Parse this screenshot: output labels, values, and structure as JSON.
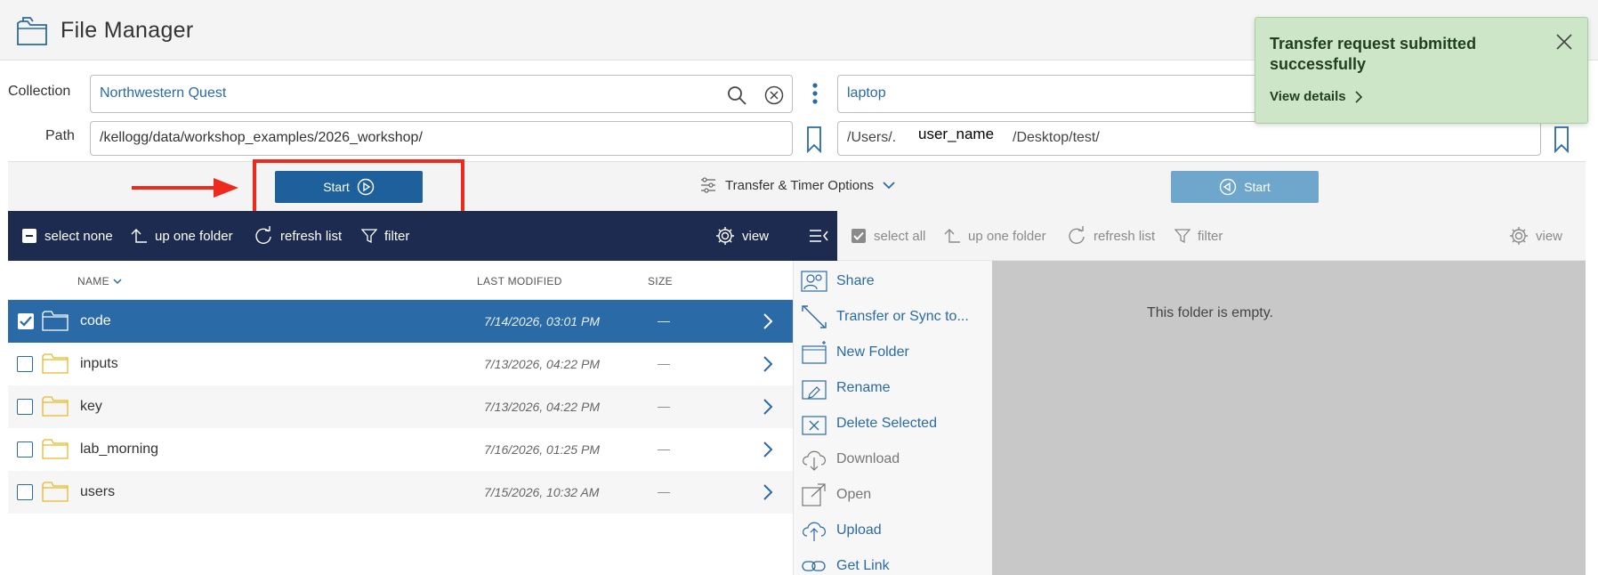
{
  "header": {
    "title": "File Manager",
    "icon": "folder-outline-icon"
  },
  "left": {
    "collection_label": "Collection",
    "collection_value": "Northwestern Quest",
    "path_label": "Path",
    "path_value": "/kellogg/data/workshop_examples/2026_workshop/"
  },
  "right": {
    "collection_value": "laptop",
    "path_prefix": "/Users/.",
    "path_user": "user_name",
    "path_suffix": "/Desktop/test/"
  },
  "transfer": {
    "start_label": "Start",
    "options_label": "Transfer & Timer Options",
    "start_right_label": "Start"
  },
  "left_toolbar": {
    "select": "select none",
    "up": "up one folder",
    "refresh": "refresh list",
    "filter": "filter",
    "view": "view"
  },
  "right_toolbar": {
    "select": "select all",
    "up": "up one folder",
    "refresh": "refresh list",
    "filter": "filter",
    "view": "view"
  },
  "file_list": {
    "col_name": "NAME",
    "col_modified": "LAST MODIFIED",
    "col_size": "SIZE",
    "rows": [
      {
        "name": "code",
        "modified": "7/14/2026, 03:01 PM",
        "size": "—",
        "selected": true
      },
      {
        "name": "inputs",
        "modified": "7/13/2026, 04:22 PM",
        "size": "—",
        "selected": false
      },
      {
        "name": "key",
        "modified": "7/13/2026, 04:22 PM",
        "size": "—",
        "selected": false
      },
      {
        "name": "lab_morning",
        "modified": "7/16/2026, 01:25 PM",
        "size": "—",
        "selected": false
      },
      {
        "name": "users",
        "modified": "7/15/2026, 10:32 AM",
        "size": "—",
        "selected": false
      }
    ]
  },
  "menu": {
    "items": [
      {
        "label": "Share",
        "enabled": true
      },
      {
        "label": "Transfer or Sync to...",
        "enabled": true
      },
      {
        "label": "New Folder",
        "enabled": true
      },
      {
        "label": "Rename",
        "enabled": true
      },
      {
        "label": "Delete Selected",
        "enabled": true
      },
      {
        "label": "Download",
        "enabled": false
      },
      {
        "label": "Open",
        "enabled": false
      },
      {
        "label": "Upload",
        "enabled": true
      },
      {
        "label": "Get Link",
        "enabled": true
      }
    ]
  },
  "right_pane": {
    "empty_message": "This folder is empty."
  },
  "toast": {
    "title": "Transfer request submitted successfully",
    "link": "View details"
  },
  "colors": {
    "primary": "#1e609b",
    "nav": "#1c2b4f",
    "selected_row": "#2a6aa6",
    "highlight": "#ee2a1f",
    "toast_bg": "#cde6c7"
  }
}
